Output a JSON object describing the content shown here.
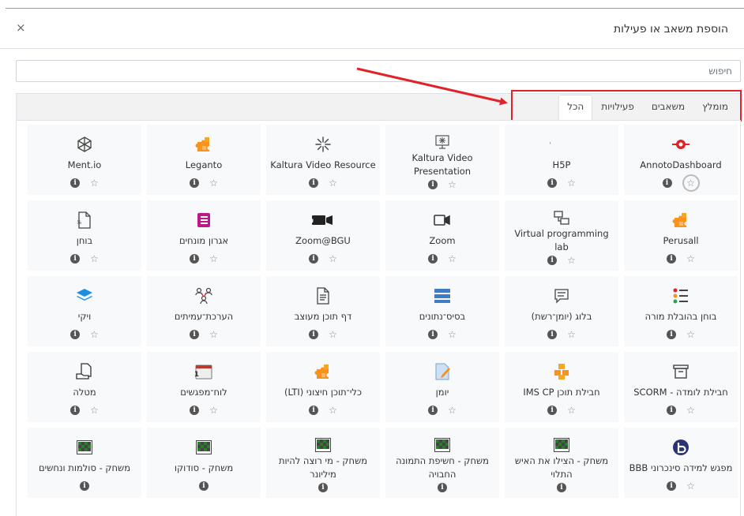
{
  "dialog": {
    "title": "הוספת משאב או פעילות",
    "close_label": "×"
  },
  "search": {
    "placeholder": "חיפוש",
    "value": ""
  },
  "tabs": [
    {
      "label": "הכל",
      "active": true
    },
    {
      "label": "פעילויות",
      "active": false
    },
    {
      "label": "משאבים",
      "active": false
    },
    {
      "label": "מומלץ",
      "active": false
    }
  ],
  "items": [
    {
      "name": "AnnotoDashboard",
      "icon": "annoto-icon",
      "star_highlight": true,
      "star": true
    },
    {
      "name": "H5P",
      "icon": "h5p-icon",
      "star": true
    },
    {
      "name": "Kaltura Video Presentation",
      "icon": "kaltura-presentation-icon",
      "star": true
    },
    {
      "name": "Kaltura Video Resource",
      "icon": "kaltura-resource-icon",
      "star": true
    },
    {
      "name": "Leganto",
      "icon": "puzzle-icon",
      "star": true
    },
    {
      "name": "Ment.io",
      "icon": "mentio-icon",
      "star": true
    },
    {
      "name": "Perusall",
      "icon": "puzzle-icon",
      "star": true
    },
    {
      "name": "Virtual programming lab",
      "icon": "vpl-icon",
      "star": true
    },
    {
      "name": "Zoom",
      "icon": "zoom-camera-icon",
      "star": true
    },
    {
      "name": "Zoom@BGU",
      "icon": "zoom-bgu-icon",
      "star": true
    },
    {
      "name": "אגרון מונחים",
      "icon": "glossary-icon",
      "star": true
    },
    {
      "name": "בוחן",
      "icon": "quiz-icon",
      "star": true
    },
    {
      "name": "בוחן בהובלת מורה",
      "icon": "teacher-quiz-icon",
      "star": true
    },
    {
      "name": "בלוג (יומן־רשת)",
      "icon": "blog-icon",
      "star": true
    },
    {
      "name": "בסיס־נתונים",
      "icon": "database-icon",
      "star": true
    },
    {
      "name": "דף תוכן מעוצב",
      "icon": "page-icon",
      "star": true
    },
    {
      "name": "הערכת־עמיתים",
      "icon": "workshop-icon",
      "star": true
    },
    {
      "name": "ויקי",
      "icon": "wiki-icon",
      "star": true
    },
    {
      "name": "חבילת לומדה - SCORM",
      "icon": "scorm-icon",
      "star": true
    },
    {
      "name": "חבילת תוכן IMS CP",
      "icon": "ims-icon",
      "star": true
    },
    {
      "name": "יומן",
      "icon": "journal-icon",
      "star": true
    },
    {
      "name": "כלי־תוכן חיצוני (LTI)",
      "icon": "puzzle-icon",
      "star": true
    },
    {
      "name": "לוח־מפגשים",
      "icon": "calendar-icon",
      "cal_day": "31",
      "star": true
    },
    {
      "name": "מטלה",
      "icon": "assignment-icon",
      "star": true
    },
    {
      "name": "מפגש למידה סינכרוני BBB",
      "icon": "bbb-icon",
      "star": true
    },
    {
      "name": "משחק - הצילו את האיש התלוי",
      "icon": "game-icon",
      "star": false
    },
    {
      "name": "משחק - חשיפת התמונה החבויה",
      "icon": "game-icon",
      "star": false
    },
    {
      "name": "משחק - מי רוצה להיות מיליונר",
      "icon": "game-icon",
      "star": false
    },
    {
      "name": "משחק - סודוקו",
      "icon": "game-icon",
      "star": false
    },
    {
      "name": "משחק - סולמות ונחשים",
      "icon": "game-icon",
      "star": false
    }
  ],
  "info_glyph": "i",
  "star_glyph": "☆",
  "colors": {
    "accent_red": "#e2222b",
    "puzzle_orange": "#f7931e",
    "glossary_magenta": "#c0168c",
    "wiki_blue": "#1a8fe3",
    "database_blue": "#3f7cc5"
  }
}
